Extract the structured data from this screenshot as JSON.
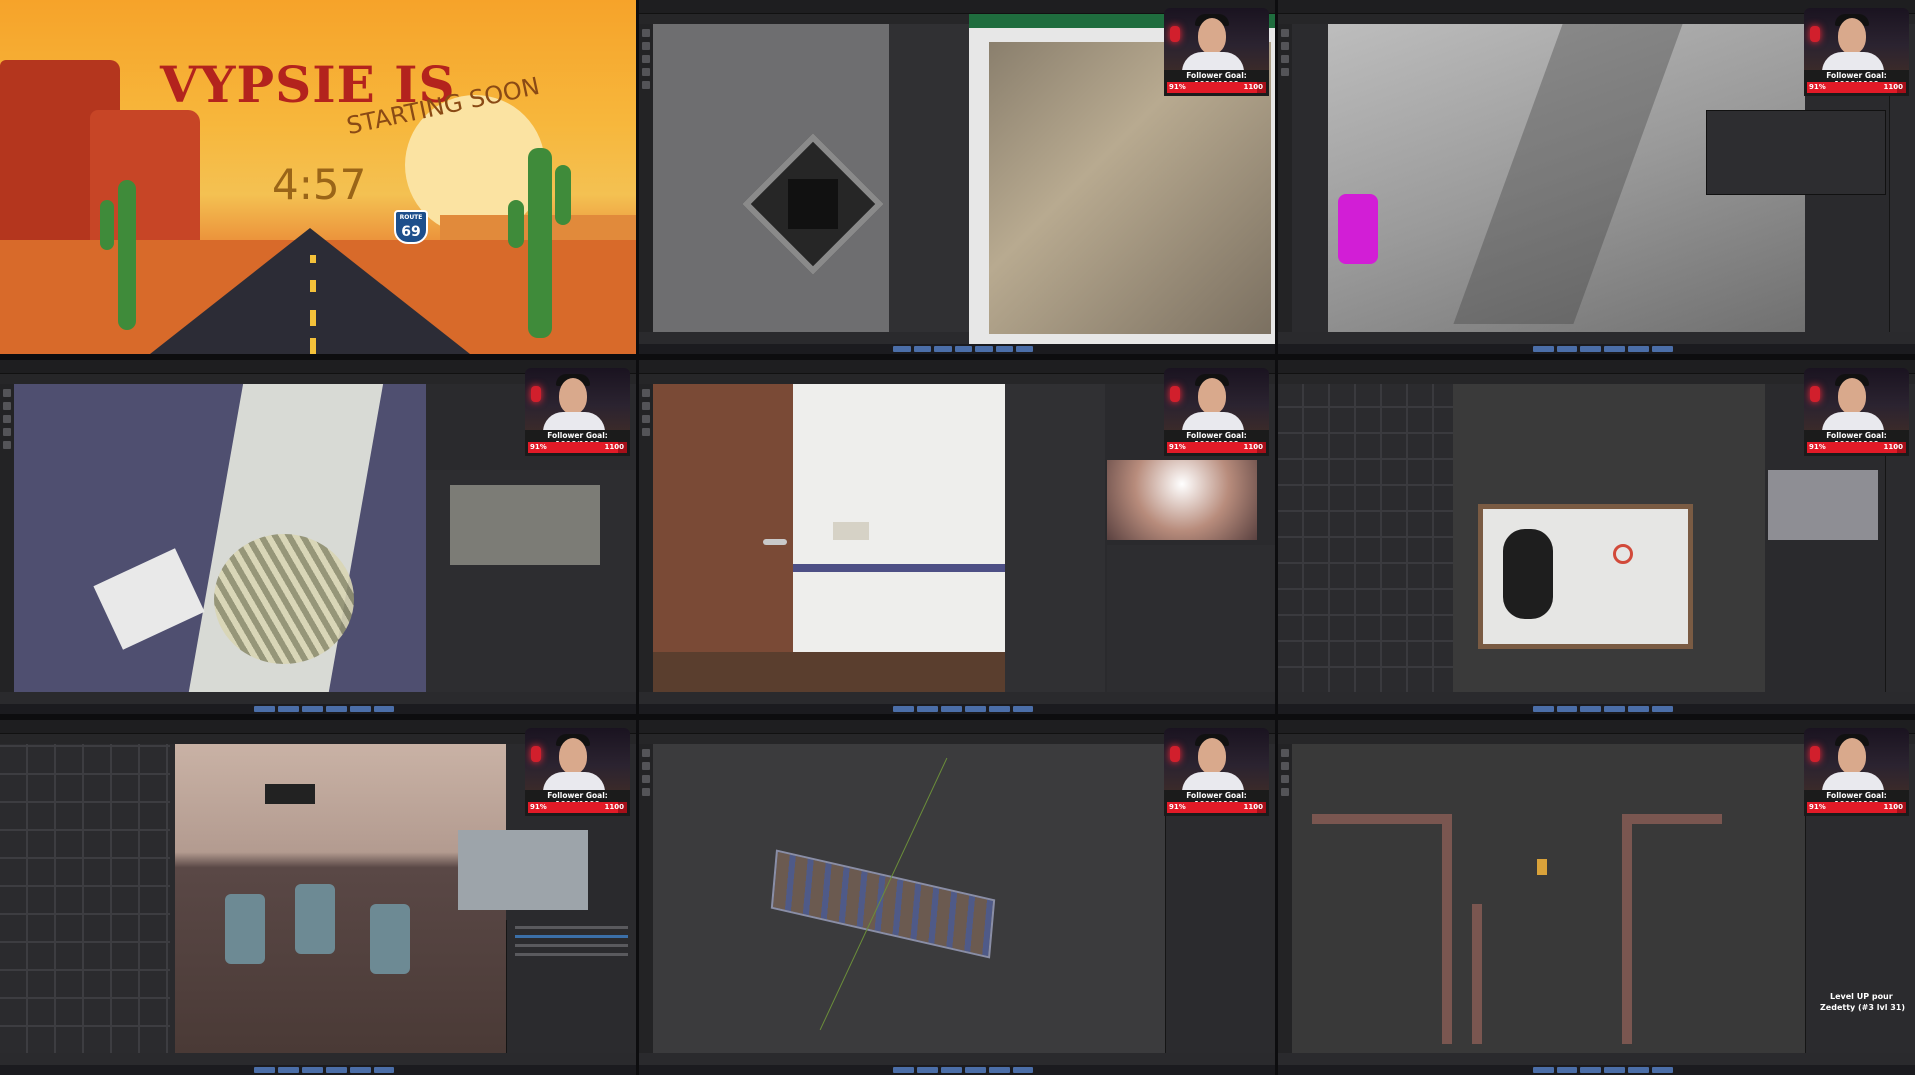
{
  "stream": {
    "headline": "VYPSIE IS",
    "subheadline": "STARTING SOON",
    "countdown": "4:57",
    "route_sign_label": "ROUTE",
    "route_sign_number": "69"
  },
  "follower_goal": {
    "label": "Follower Goal: 1006/1100",
    "percent_text": "91%",
    "target_text": "1100",
    "progress": 0.91
  },
  "notification": {
    "line1": "Level UP pour",
    "line2": "Zedetty (#3 lvl 31)"
  },
  "panels": [
    {
      "id": "starting-soon"
    },
    {
      "id": "blender-floor-pattern"
    },
    {
      "id": "blender-corridor-closeup"
    },
    {
      "id": "blender-hallway-fan"
    },
    {
      "id": "blender-door-wall"
    },
    {
      "id": "blender-asset-topview"
    },
    {
      "id": "blender-waiting-room"
    },
    {
      "id": "blender-building-overview"
    },
    {
      "id": "blender-floorplan-wire"
    }
  ],
  "colors": {
    "goal_bar": "#e21a27",
    "goal_track": "#a50f19",
    "blender_bg": "#2a2a2d",
    "selection": "#3b6fa8"
  }
}
